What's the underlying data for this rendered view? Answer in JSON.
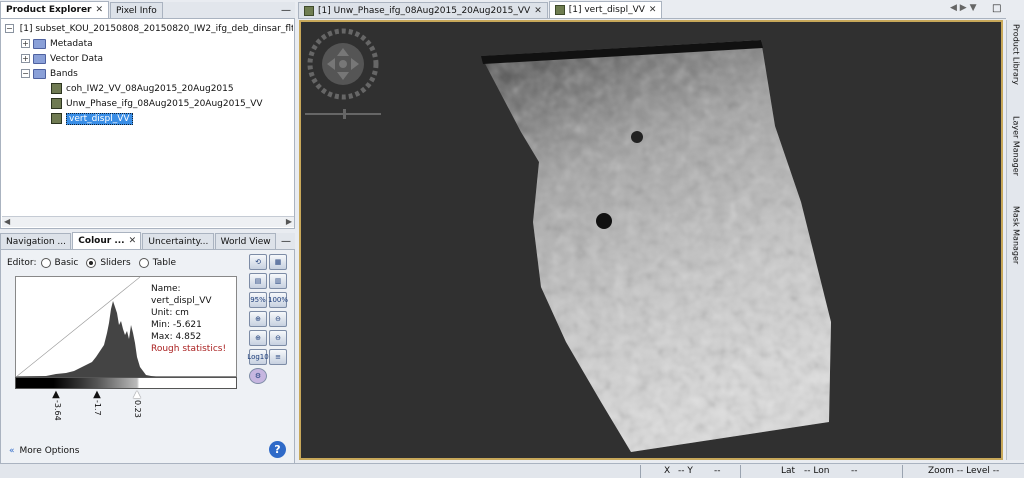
{
  "left_top": {
    "tabs": [
      {
        "label": "Product Explorer",
        "close": "✕"
      },
      {
        "label": "Pixel Info"
      }
    ],
    "tree": {
      "product": "[1] subset_KOU_20150808_20150820_IW2_ifg_deb_dinsar_flt_ML",
      "nodes": [
        {
          "label": "Metadata"
        },
        {
          "label": "Vector Data"
        },
        {
          "label": "Bands"
        }
      ],
      "bands": [
        {
          "label": "coh_IW2_VV_08Aug2015_20Aug2015"
        },
        {
          "label": "Unw_Phase_ifg_08Aug2015_20Aug2015_VV"
        },
        {
          "label": "vert_displ_VV"
        }
      ]
    }
  },
  "left_bottom": {
    "tabs": [
      {
        "label": "Navigation ..."
      },
      {
        "label": "Colour ...",
        "close": "✕"
      },
      {
        "label": "Uncertainty..."
      },
      {
        "label": "World View"
      }
    ],
    "editor": {
      "label": "Editor:",
      "options": [
        "Basic",
        "Sliders",
        "Table"
      ],
      "selected": "Sliders"
    },
    "info": {
      "name": "Name: vert_displ_VV",
      "unit": "Unit: cm",
      "min": "Min: -5.621",
      "max": "Max: 4.852",
      "warning": "Rough statistics!"
    },
    "sliders": [
      "-3.64",
      "-1.7",
      "0.23"
    ],
    "tools": {
      "zoom95": "95%",
      "zoom100": "100%",
      "log": "Log10"
    },
    "more_options": "More Options",
    "help": "?"
  },
  "view": {
    "tabs": [
      {
        "label": "[1] Unw_Phase_ifg_08Aug2015_20Aug2015_VV",
        "close": "✕"
      },
      {
        "label": "[1] vert_displ_VV",
        "close": "✕"
      }
    ],
    "minimize": "—",
    "nav_left": "◀",
    "nav_right": "▶",
    "nav_down": "▼"
  },
  "right_strip": [
    "Product Library",
    "Layer Manager",
    "Mask Manager"
  ],
  "status": {
    "x": "X",
    "x_val": "-- Y",
    "y_val": "--",
    "lat": "Lat",
    "lat_val": "-- Lon",
    "lon_val": "--",
    "zoom": "Zoom -- Level --"
  },
  "colors": {
    "accent": "#3a8ee6",
    "view_bg": "#303030",
    "view_border": "#c8a85a",
    "warning": "#aa2222"
  }
}
